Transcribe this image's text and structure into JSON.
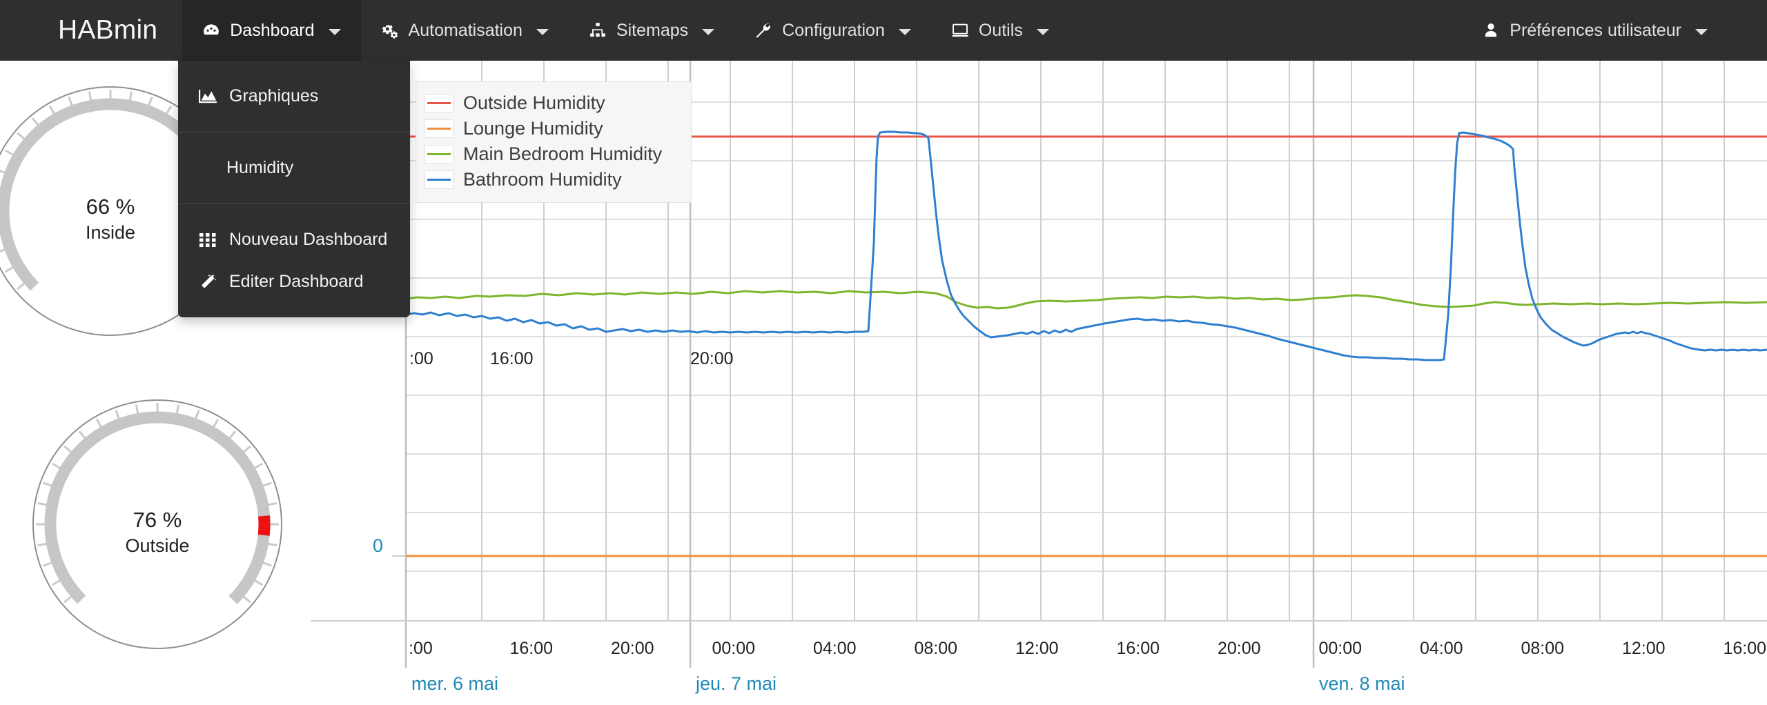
{
  "navbar": {
    "brand": "HABmin",
    "items": [
      {
        "label": "Dashboard",
        "icon": "dashboard-icon",
        "active": true,
        "caret": true
      },
      {
        "label": "Automatisation",
        "icon": "gears-icon",
        "active": false,
        "caret": true
      },
      {
        "label": "Sitemaps",
        "icon": "sitemap-icon",
        "active": false,
        "caret": true
      },
      {
        "label": "Configuration",
        "icon": "wrench-icon",
        "active": false,
        "caret": true
      },
      {
        "label": "Outils",
        "icon": "desktop-icon",
        "active": false,
        "caret": true
      }
    ],
    "user_menu": {
      "label": "Préférences utilisateur",
      "icon": "user-icon",
      "caret": true
    }
  },
  "dropdown": {
    "open_for": "Dashboard",
    "sections": [
      {
        "items": [
          {
            "label": "Graphiques",
            "icon": "area-chart-icon",
            "indent": false
          }
        ]
      },
      {
        "items": [
          {
            "label": "Humidity",
            "icon": "none",
            "indent": true
          }
        ]
      },
      {
        "items": [
          {
            "label": "Nouveau Dashboard",
            "icon": "grid-icon",
            "indent": false
          },
          {
            "label": "Editer Dashboard",
            "icon": "magic-wand-icon",
            "indent": false
          }
        ]
      }
    ]
  },
  "gauges": [
    {
      "value": "66 %",
      "label": "Inside",
      "percent": 66,
      "marker_percent": null,
      "marker_color": "#ee1111"
    },
    {
      "value": "76 %",
      "label": "Outside",
      "percent": 76,
      "marker_percent": 76,
      "marker_color": "#ee1111"
    }
  ],
  "legend": {
    "entries": [
      {
        "label": "Outside Humidity",
        "color": "#e8564a"
      },
      {
        "label": "Lounge Humidity",
        "color": "#ef8e3f"
      },
      {
        "label": "Main Bedroom Humidity",
        "color": "#7db52d"
      },
      {
        "label": "Bathroom Humidity",
        "color": "#2f7fd1"
      }
    ]
  },
  "chart_data": {
    "type": "line",
    "title": "",
    "xlabel": "",
    "ylabel": "",
    "grid": true,
    "legend_position": "top-left",
    "y_tick_labels": [
      "0"
    ],
    "y_tick_values": [
      0
    ],
    "ylim": [
      -20,
      100
    ],
    "x_tick_labels": [
      ":00",
      "16:00",
      "20:00",
      "00:00",
      "04:00",
      "08:00",
      "12:00",
      "16:00",
      "20:00",
      "00:00",
      "04:00",
      "08:00",
      "12:00",
      "16:00"
    ],
    "x_date_labels": [
      "mer. 6 mai",
      "jeu. 7 mai",
      "ven. 8 mai"
    ],
    "series": [
      {
        "name": "Outside Humidity",
        "color": "#e8564a",
        "style": "flat-top",
        "value": 100
      },
      {
        "name": "Lounge Humidity",
        "color": "#ef8e3f",
        "style": "flat-zero",
        "value": 0
      },
      {
        "name": "Main Bedroom Humidity",
        "color": "#7db52d",
        "style": "mid-band",
        "value_range": [
          45,
          52
        ]
      },
      {
        "name": "Bathroom Humidity",
        "color": "#2f7fd1",
        "style": "spiky",
        "value_range": [
          30,
          100
        ]
      }
    ]
  }
}
